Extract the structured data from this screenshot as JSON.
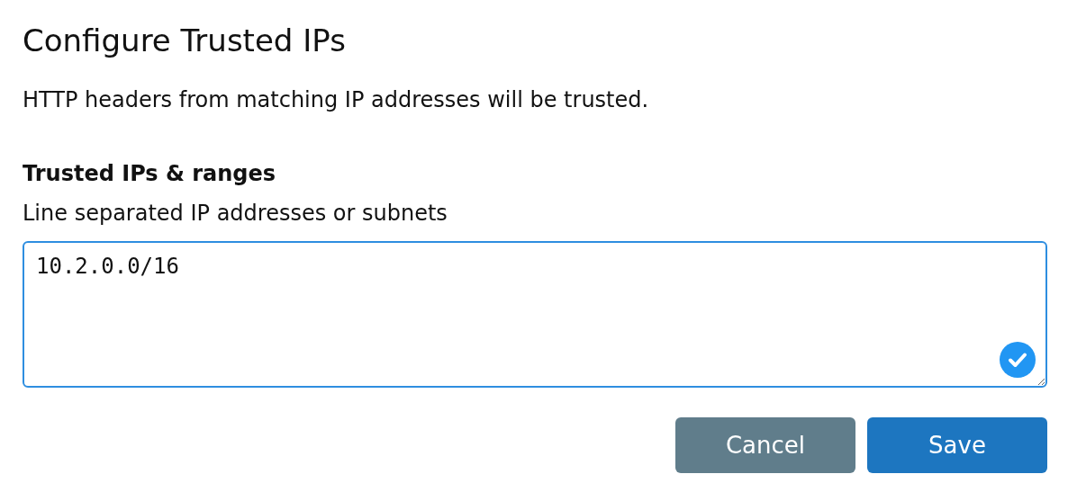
{
  "dialog": {
    "title": "Configure Trusted IPs",
    "description": "HTTP headers from matching IP addresses will be trusted."
  },
  "field": {
    "label": "Trusted IPs & ranges",
    "hint": "Line separated IP addresses or subnets",
    "value": "10.2.0.0/16",
    "valid": true
  },
  "buttons": [
    {
      "label": "Cancel",
      "kind": "secondary"
    },
    {
      "label": "Save",
      "kind": "primary"
    }
  ]
}
